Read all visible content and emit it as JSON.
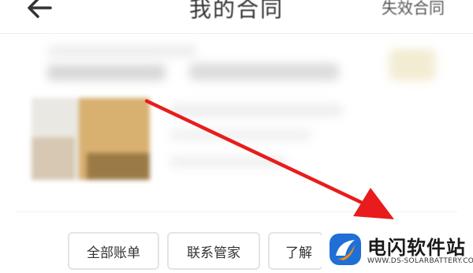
{
  "header": {
    "back_icon": "arrow-left-icon",
    "title": "我的合同",
    "action_label": "失效合同"
  },
  "actions": {
    "all_bills": "全部账单",
    "contact_manager": "联系管家",
    "learn_more": "了解"
  },
  "annotation": {
    "arrow_color": "#e81c1c"
  },
  "watermark": {
    "name": "电闪软件站",
    "url": "WWW.DS-SOLARBATTERY.COM",
    "logo_colors": [
      "#1f6fd6",
      "#f28c1e"
    ]
  }
}
